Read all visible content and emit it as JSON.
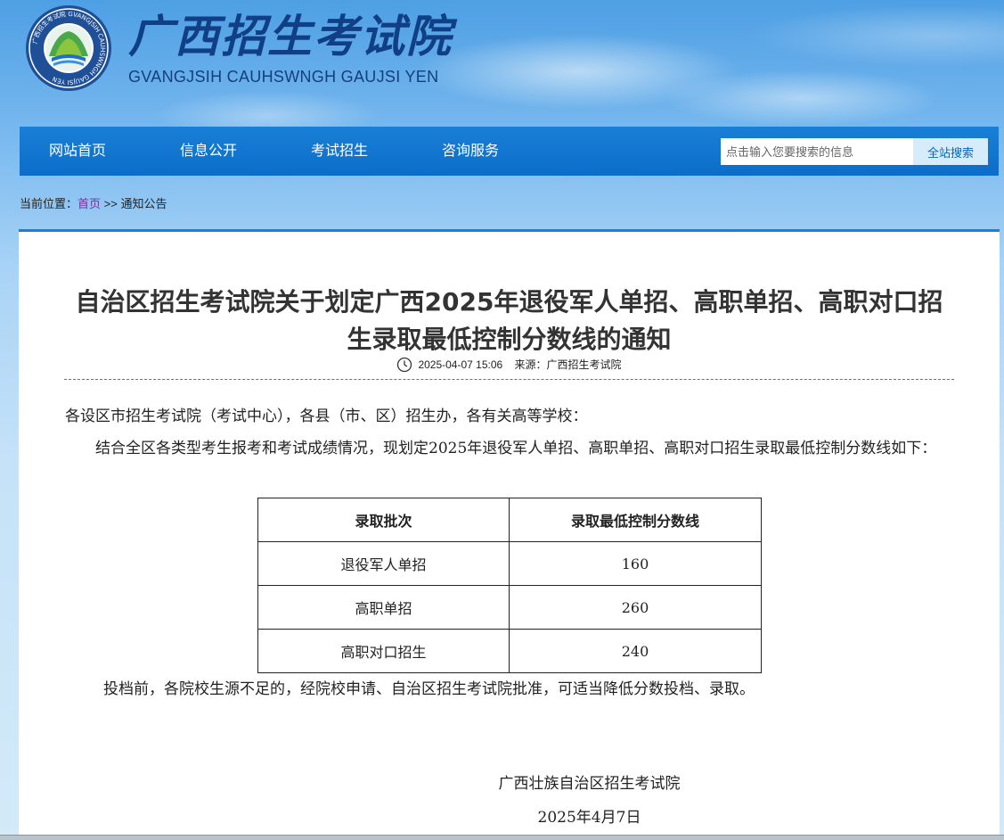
{
  "header": {
    "title": "广西招生考试院",
    "subtitle": "GVANGJSIH CAUHSWNGH GAUJSI YEN",
    "logo_ring_text": "广西招生考试院 GVANGJSIH CAUHSWNGH GAUJSI YEN"
  },
  "nav": {
    "items": [
      {
        "label": "网站首页"
      },
      {
        "label": "信息公开"
      },
      {
        "label": "考试招生"
      },
      {
        "label": "咨询服务"
      }
    ],
    "search": {
      "placeholder": "点击输入您要搜索的信息",
      "button_label": "全站搜索"
    }
  },
  "breadcrumb": {
    "prefix": "当前位置：",
    "home": "首页",
    "separator": " >> ",
    "current": "通知公告"
  },
  "article": {
    "title": "自治区招生考试院关于划定广西2025年退役军人单招、高职单招、高职对口招生录取最低控制分数线的通知",
    "date": "2025-04-07 15:06",
    "source": "来源：广西招生考试院",
    "paragraph1": "各设区市招生考试院（考试中心），各县（市、区）招生办，各有关高等学校：",
    "paragraph2": "结合全区各类型考生报考和考试成绩情况，现划定2025年退役军人单招、高职单招、高职对口招生录取最低控制分数线如下：",
    "table": {
      "headers": [
        "录取批次",
        "录取最低控制分数线"
      ],
      "rows": [
        [
          "退役军人单招",
          "160"
        ],
        [
          "高职单招",
          "260"
        ],
        [
          "高职对口招生",
          "240"
        ]
      ]
    },
    "paragraph3": "投档前，各院校生源不足的，经院校申请、自治区招生考试院批准，可适当降低分数投档、录取。",
    "signature_org": "广西壮族自治区招生考试院",
    "signature_date": "2025年4月7日"
  },
  "colors": {
    "nav_bg": "#0b6dc8",
    "title_blue": "#103f86",
    "link_purple": "#7a2f9e"
  }
}
